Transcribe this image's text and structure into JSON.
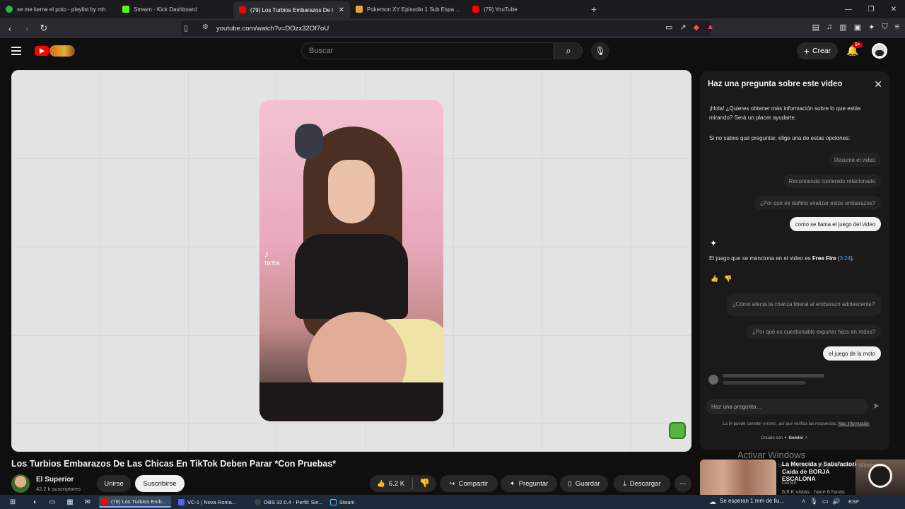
{
  "browser": {
    "tabs": [
      {
        "title": "se me kema el poto - playlist by mh",
        "color": "#1db954"
      },
      {
        "title": "Stream - Kick Dashboard",
        "color": "#53fc18"
      },
      {
        "title": "(79) Los Turbios Embarazos De l",
        "color": "#ff0000",
        "active": true
      },
      {
        "title": "Pokemon XY Episodio 1 Sub Español",
        "color": "#e8a33b"
      },
      {
        "title": "(79) YouTube",
        "color": "#ff0000"
      }
    ],
    "url": "youtube.com/watch?v=DOzx32Of7oU"
  },
  "masthead": {
    "search_placeholder": "Buscar",
    "create_label": "Crear",
    "notifications_badge": "9+"
  },
  "video": {
    "title": "Los Turbios Embarazos De Las Chicas En TikTok Deben Parar *Con Pruebas*",
    "tiktok_label": "TikTok",
    "channel_name": "El Superior",
    "subscribers": "42.2 k suscriptores",
    "join_label": "Unirse",
    "subscribe_label": "Suscribirse",
    "likes": "6.2 K",
    "share_label": "Compartir",
    "ask_label": "Preguntar",
    "save_label": "Guardar",
    "download_label": "Descargar"
  },
  "ask_panel": {
    "title": "Haz una pregunta sobre este video",
    "intro": "¡Hola! ¿Quieres obtener más información sobre lo que estás mirando? Será un placer ayudarte.",
    "hint": "Si no sabes qué preguntar, elige una de estas opciones:",
    "suggestions": [
      "Resume el video",
      "Recomienda contenido relacionado",
      "¿Por qué es dañino viralizar estos embarazos?"
    ],
    "user_question_1": "como se llama el juego del video",
    "answer_prefix": "El juego que se menciona en el video es ",
    "answer_game": "Free Fire",
    "answer_ts": "3:24",
    "answer_suffix": ").",
    "followups": [
      "¿Cómo afecta la crianza liberal al embarazo adolescente?",
      "¿Por qué es cuestionable exponer hijos en redes?"
    ],
    "user_question_2": "el juego de la moto",
    "input_placeholder": "Haz una pregunta...",
    "disclaimer": "La IA puede cometer errores, así que verifica las respuestas.",
    "disclaimer_link": "Más información",
    "created_with_prefix": "Creado con",
    "created_with_brand": "Gemini"
  },
  "overlay": {
    "activate_windows": "Activar Windows",
    "activate_sub": "Ve a Configuración para activar Windows."
  },
  "recommendation": {
    "title": "La Merecida y Satisfactoria Caída de BORJA ESCALONA",
    "channel": "DANX",
    "meta": "6.8 K vistas · hace 6 horas"
  },
  "taskbar": {
    "tasks": [
      {
        "label": "(79) Los Turbios Emb...",
        "color": "#ff0000",
        "active": true
      },
      {
        "label": "VC-1 | Nova Roma...",
        "color": "#5865f2"
      },
      {
        "label": "OBS 32.0.4 - Perfil: Sin...",
        "color": "#444444"
      },
      {
        "label": "Steam",
        "color": "#1b2838"
      }
    ],
    "weather": "Se esperan 1 mm de llu...",
    "lang": "ESP"
  }
}
